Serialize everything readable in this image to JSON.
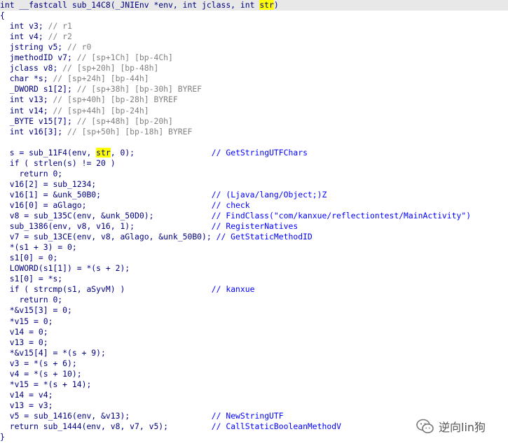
{
  "code_lines": [
    {
      "indent": 0,
      "tokens": [
        {
          "t": "int __fastcall sub_14C8(_JNIEnv *env, int jclass, int "
        },
        {
          "t": "str",
          "hl": true
        },
        {
          "t": ")"
        }
      ]
    },
    {
      "indent": 0,
      "tokens": [
        {
          "t": "{"
        }
      ]
    },
    {
      "indent": 2,
      "tokens": [
        {
          "t": "int v3; // r1"
        }
      ]
    },
    {
      "indent": 2,
      "tokens": [
        {
          "t": "int v4; // r2"
        }
      ]
    },
    {
      "indent": 2,
      "tokens": [
        {
          "t": "jstring v5; // r0"
        }
      ]
    },
    {
      "indent": 2,
      "tokens": [
        {
          "t": "jmethodID v7; // [sp+1Ch] [bp-4Ch]"
        }
      ]
    },
    {
      "indent": 2,
      "tokens": [
        {
          "t": "jclass v8; // [sp+20h] [bp-48h]"
        }
      ]
    },
    {
      "indent": 2,
      "tokens": [
        {
          "t": "char *s; // [sp+24h] [bp-44h]"
        }
      ]
    },
    {
      "indent": 2,
      "tokens": [
        {
          "t": "_DWORD s1[2]; // [sp+38h] [bp-30h] BYREF"
        }
      ]
    },
    {
      "indent": 2,
      "tokens": [
        {
          "t": "int v13; // [sp+40h] [bp-28h] BYREF"
        }
      ]
    },
    {
      "indent": 2,
      "tokens": [
        {
          "t": "int v14; // [sp+44h] [bp-24h]"
        }
      ]
    },
    {
      "indent": 2,
      "tokens": [
        {
          "t": "_BYTE v15[7]; // [sp+48h] [bp-20h]"
        }
      ]
    },
    {
      "indent": 2,
      "tokens": [
        {
          "t": "int v16[3]; // [sp+50h] [bp-18h] BYREF"
        }
      ]
    },
    {
      "indent": 0,
      "tokens": []
    },
    {
      "indent": 2,
      "tokens": [
        {
          "t": "s = sub_11F4(env, "
        },
        {
          "t": "str",
          "hl": true
        },
        {
          "t": ", 0);"
        }
      ],
      "comment": "// GetStringUTFChars"
    },
    {
      "indent": 2,
      "tokens": [
        {
          "t": "if ( strlen(s) != 20 )"
        }
      ]
    },
    {
      "indent": 4,
      "tokens": [
        {
          "t": "return 0;"
        }
      ]
    },
    {
      "indent": 2,
      "tokens": [
        {
          "t": "v16[2] = sub_1234;"
        }
      ]
    },
    {
      "indent": 2,
      "tokens": [
        {
          "t": "v16[1] = &unk_50B0;"
        }
      ],
      "comment": "// (Ljava/lang/Object;)Z"
    },
    {
      "indent": 2,
      "tokens": [
        {
          "t": "v16[0] = aGlago;"
        }
      ],
      "comment": "// check"
    },
    {
      "indent": 2,
      "tokens": [
        {
          "t": "v8 = sub_135C(env, &unk_50D0);"
        }
      ],
      "comment": "// FindClass(\"com/kanxue/reflectiontest/MainActivity\")"
    },
    {
      "indent": 2,
      "tokens": [
        {
          "t": "sub_1386(env, v8, v16, 1);"
        }
      ],
      "comment": "// RegisterNatives"
    },
    {
      "indent": 2,
      "tokens": [
        {
          "t": "v7 = sub_13CE(env, v8, aGlago, &unk_50B0);"
        }
      ],
      "comment": "// GetStaticMethodID"
    },
    {
      "indent": 2,
      "tokens": [
        {
          "t": "*(s1 + 3) = 0;"
        }
      ]
    },
    {
      "indent": 2,
      "tokens": [
        {
          "t": "s1[0] = 0;"
        }
      ]
    },
    {
      "indent": 2,
      "tokens": [
        {
          "t": "LOWORD(s1[1]) = *(s + 2);"
        }
      ]
    },
    {
      "indent": 2,
      "tokens": [
        {
          "t": "s1[0] = *s;"
        }
      ]
    },
    {
      "indent": 2,
      "tokens": [
        {
          "t": "if ( strcmp(s1, aSyvM) )"
        }
      ],
      "comment": "// kanxue"
    },
    {
      "indent": 4,
      "tokens": [
        {
          "t": "return 0;"
        }
      ]
    },
    {
      "indent": 2,
      "tokens": [
        {
          "t": "*&v15[3] = 0;"
        }
      ]
    },
    {
      "indent": 2,
      "tokens": [
        {
          "t": "*v15 = 0;"
        }
      ]
    },
    {
      "indent": 2,
      "tokens": [
        {
          "t": "v14 = 0;"
        }
      ]
    },
    {
      "indent": 2,
      "tokens": [
        {
          "t": "v13 = 0;"
        }
      ]
    },
    {
      "indent": 2,
      "tokens": [
        {
          "t": "*&v15[4] = *(s + 9);"
        }
      ]
    },
    {
      "indent": 2,
      "tokens": [
        {
          "t": "v3 = *(s + 6);"
        }
      ]
    },
    {
      "indent": 2,
      "tokens": [
        {
          "t": "v4 = *(s + 10);"
        }
      ]
    },
    {
      "indent": 2,
      "tokens": [
        {
          "t": "*v15 = *(s + 14);"
        }
      ]
    },
    {
      "indent": 2,
      "tokens": [
        {
          "t": "v14 = v4;"
        }
      ]
    },
    {
      "indent": 2,
      "tokens": [
        {
          "t": "v13 = v3;"
        }
      ]
    },
    {
      "indent": 2,
      "tokens": [
        {
          "t": "v5 = sub_1416(env, &v13);"
        }
      ],
      "comment": "// NewStringUTF"
    },
    {
      "indent": 2,
      "tokens": [
        {
          "t": "return sub_1444(env, v8, v7, v5);"
        }
      ],
      "comment": "// CallStaticBooleanMethodV"
    },
    {
      "indent": 0,
      "tokens": [
        {
          "t": "}"
        }
      ]
    }
  ],
  "watermark": {
    "text": "逆向lin狗",
    "icon": "wechat-icon"
  },
  "colors": {
    "code_text": "#000080",
    "comment": "#0000ff",
    "declaration_comment": "#808080",
    "highlight": "#ffff00",
    "header_background": "#e8e8e8",
    "background": "#ffffff"
  }
}
